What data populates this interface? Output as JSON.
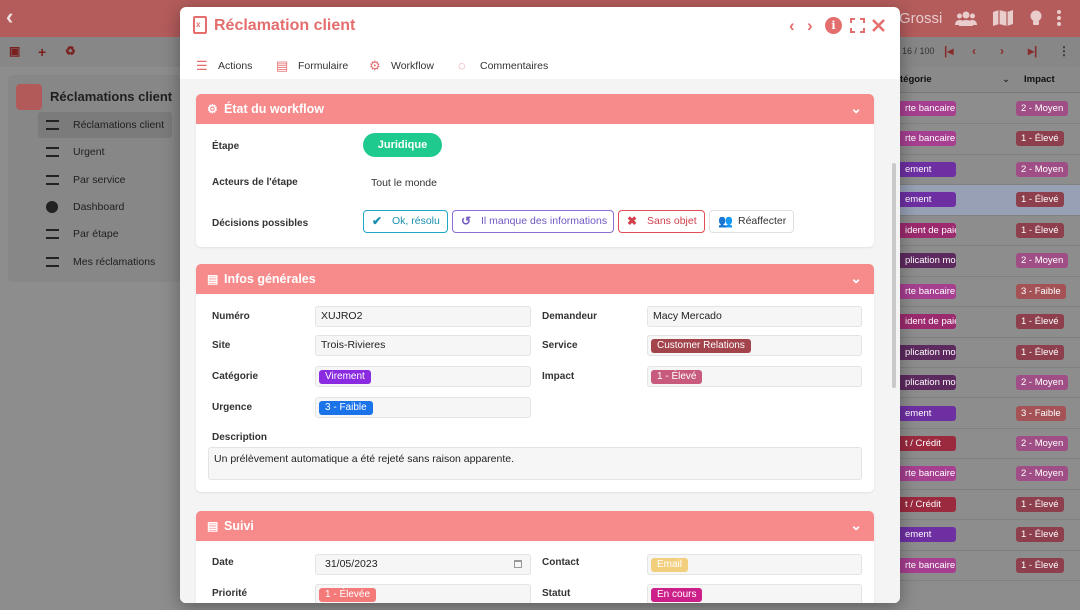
{
  "background": {
    "user": "Grossi",
    "sidebar": {
      "title": "Réclamations client",
      "items": [
        {
          "label": "Réclamations client",
          "selected": true
        },
        {
          "label": "Urgent"
        },
        {
          "label": "Par service"
        },
        {
          "label": "Dashboard"
        },
        {
          "label": "Par étape"
        },
        {
          "label": "Mes réclamations"
        }
      ]
    },
    "table": {
      "pager": "16 / 100",
      "columns": [
        "tégorie",
        "Impact"
      ],
      "rows": [
        {
          "cat": "rte bancaire",
          "cat_color": "#a63f90",
          "imp": "2 - Moyen",
          "imp_color": "#a04f86"
        },
        {
          "cat": "rte bancaire",
          "cat_color": "#a63f90",
          "imp": "1 - Élevé",
          "imp_color": "#8e3f4d"
        },
        {
          "cat": "ement",
          "cat_color": "#6e2fa3",
          "imp": "2 - Moyen",
          "imp_color": "#a04f86"
        },
        {
          "cat": "ement",
          "cat_color": "#6e2fa3",
          "imp": "1 - Élevé",
          "imp_color": "#8e3f4d",
          "highlight": true
        },
        {
          "cat": "ident de paiement",
          "cat_color": "#9c2a6e",
          "imp": "1 - Élevé",
          "imp_color": "#8e3f4d"
        },
        {
          "cat": "plication mobile",
          "cat_color": "#5d2a5f",
          "imp": "2 - Moyen",
          "imp_color": "#a04f86"
        },
        {
          "cat": "rte bancaire",
          "cat_color": "#a63f90",
          "imp": "3 - Faible",
          "imp_color": "#a45256"
        },
        {
          "cat": "ident de paiement",
          "cat_color": "#9c2a6e",
          "imp": "1 - Élevé",
          "imp_color": "#8e3f4d"
        },
        {
          "cat": "plication mobile",
          "cat_color": "#5d2a5f",
          "imp": "1 - Élevé",
          "imp_color": "#8e3f4d"
        },
        {
          "cat": "plication mobile",
          "cat_color": "#5d2a5f",
          "imp": "2 - Moyen",
          "imp_color": "#a04f86"
        },
        {
          "cat": "ement",
          "cat_color": "#6e2fa3",
          "imp": "3 - Faible",
          "imp_color": "#a45256"
        },
        {
          "cat": "t / Crédit",
          "cat_color": "#9b2a3f",
          "imp": "2 - Moyen",
          "imp_color": "#a04f86"
        },
        {
          "cat": "rte bancaire",
          "cat_color": "#a63f90",
          "imp": "2 - Moyen",
          "imp_color": "#a04f86"
        },
        {
          "cat": "t / Crédit",
          "cat_color": "#9b2a3f",
          "imp": "1 - Élevé",
          "imp_color": "#8e3f4d"
        },
        {
          "cat": "ement",
          "cat_color": "#6e2fa3",
          "imp": "1 - Élevé",
          "imp_color": "#8e3f4d"
        },
        {
          "cat": "rte bancaire",
          "cat_color": "#a63f90",
          "imp": "1 - Élevé",
          "imp_color": "#8e3f4d"
        }
      ]
    }
  },
  "modal": {
    "title": "Réclamation client",
    "tabs": [
      "Actions",
      "Formulaire",
      "Workflow",
      "Commentaires"
    ],
    "accent": "#e46e6e",
    "workflow": {
      "header": "État du workflow",
      "step_label": "Étape",
      "step_value": "Juridique",
      "actors_label": "Acteurs de l'étape",
      "actors_value": "Tout le monde",
      "decisions_label": "Décisions possibles",
      "decisions": {
        "ok": "Ok, résolu",
        "missing": "Il manque des informations",
        "none": "Sans objet",
        "reassign": "Réaffecter"
      }
    },
    "general": {
      "header": "Infos générales",
      "numero_label": "Numéro",
      "numero": "XUJRO2",
      "demandeur_label": "Demandeur",
      "demandeur": "Macy Mercado",
      "site_label": "Site",
      "site": "Trois-Rivieres",
      "service_label": "Service",
      "service": "Customer Relations",
      "categorie_label": "Catégorie",
      "categorie": "Virement",
      "impact_label": "Impact",
      "impact": "1 - Élevé",
      "urgence_label": "Urgence",
      "urgence": "3 - Faible",
      "description_label": "Description",
      "description": "Un prélèvement automatique a été rejeté sans raison apparente."
    },
    "suivi": {
      "header": "Suivi",
      "date_label": "Date",
      "date": "31/05/2023",
      "contact_label": "Contact",
      "contact": "Email",
      "priorite_label": "Priorité",
      "priorite": "1 - Élevée",
      "statut_label": "Statut",
      "statut": "En cours"
    }
  }
}
